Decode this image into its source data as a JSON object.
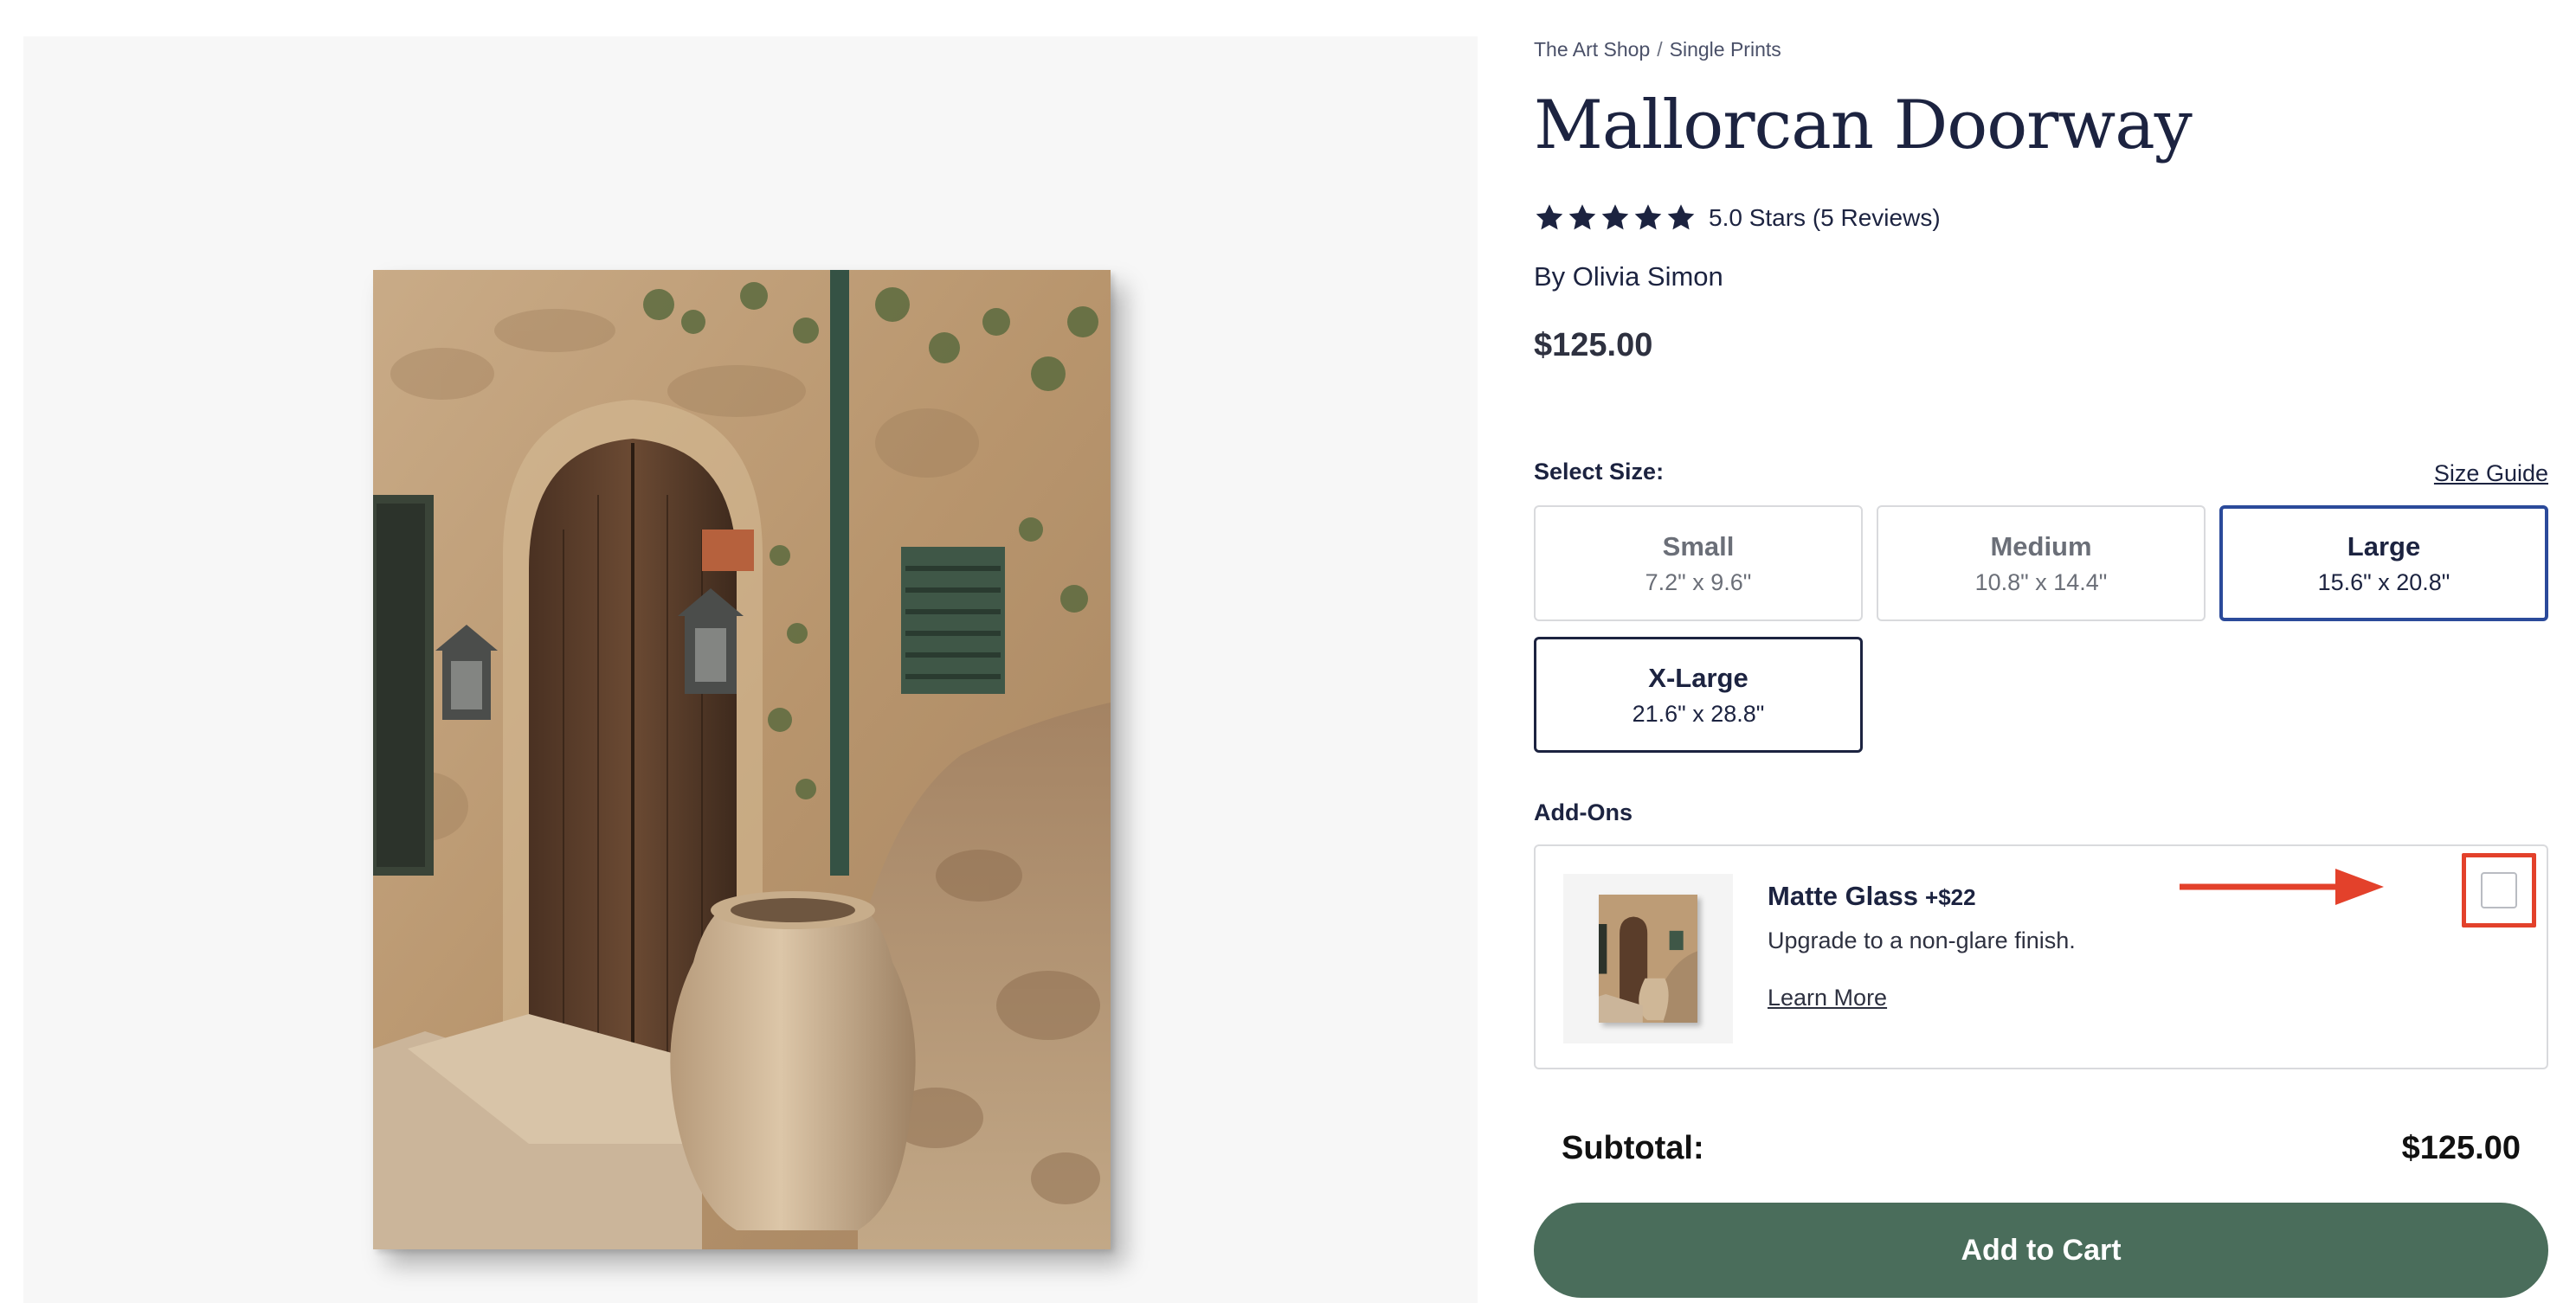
{
  "breadcrumb": {
    "home": "The Art Shop",
    "separator": "/",
    "current": "Single Prints"
  },
  "product": {
    "title": "Mallorcan Doorway",
    "rating_text": "5.0 Stars (5 Reviews)",
    "rating_value": 5.0,
    "rating_max": 5,
    "artist": "By Olivia Simon",
    "price": "$125.00",
    "image_icon": "print-image-doorway"
  },
  "sizes": {
    "label": "Select Size:",
    "guide_link": "Size Guide",
    "selected": "Large",
    "options": [
      {
        "name": "Small",
        "dims": "7.2\" x 9.6\""
      },
      {
        "name": "Medium",
        "dims": "10.8\" x 14.4\""
      },
      {
        "name": "Large",
        "dims": "15.6\" x 20.8\""
      },
      {
        "name": "X-Large",
        "dims": "21.6\" x 28.8\""
      }
    ]
  },
  "addons": {
    "label": "Add-Ons",
    "items": [
      {
        "name": "Matte Glass",
        "price": "+$22",
        "description": "Upgrade to a non-glare finish.",
        "link": "Learn More",
        "checked": false
      }
    ]
  },
  "subtotal": {
    "label": "Subtotal:",
    "value": "$125.00"
  },
  "cta": {
    "add_to_cart": "Add to Cart"
  },
  "colors": {
    "navy": "#1c2340",
    "selected_border": "#2b4a9a",
    "cta_green": "#4a6d5b",
    "annotation_red": "#e3412b"
  }
}
